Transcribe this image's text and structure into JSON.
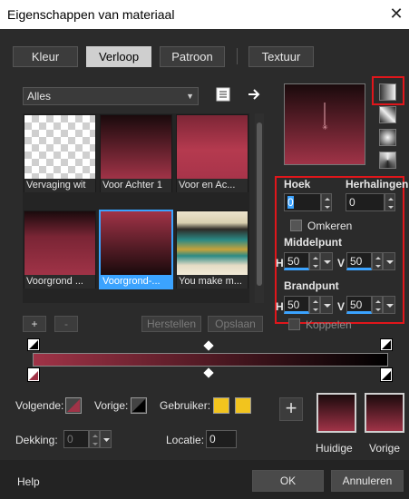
{
  "window": {
    "title": "Eigenschappen van materiaal",
    "close_glyph": "✕"
  },
  "tabs": [
    {
      "label": "Kleur"
    },
    {
      "label": "Verloop"
    },
    {
      "label": "Patroon"
    },
    {
      "label": "Textuur"
    }
  ],
  "filter": {
    "value": "Alles"
  },
  "gradients": [
    {
      "label": "Vervaging wit"
    },
    {
      "label": "Voor Achter 1"
    },
    {
      "label": "Voor en Ac..."
    },
    {
      "label": "Voorgrond ..."
    },
    {
      "label": "Voorgrond-..."
    },
    {
      "label": "You make m..."
    }
  ],
  "library_buttons": {
    "add": "+",
    "remove": "-",
    "restore": "Herstellen",
    "save": "Opslaan"
  },
  "params": {
    "angle_label": "Hoek",
    "angle_value": "0",
    "repeats_label": "Herhalingen",
    "repeats_value": "0",
    "invert_label": "Omkeren",
    "center_label": "Middelpunt",
    "center_h_label": "H",
    "center_h": "50",
    "center_v_label": "V",
    "center_v": "50",
    "focal_label": "Brandpunt",
    "focal_h_label": "H",
    "focal_h": "50",
    "focal_v_label": "V",
    "focal_v": "50",
    "link_label": "Koppelen"
  },
  "stops": {
    "next_label": "Volgende:",
    "prev_label": "Vorige:",
    "user_label": "Gebruiker:",
    "opacity_label": "Dekking:",
    "opacity_value": "0",
    "location_label": "Locatie:",
    "location_value": "0",
    "user_color": "#f2c41e"
  },
  "preview": {
    "current_label": "Huidige",
    "previous_label": "Vorige"
  },
  "footer": {
    "help": "Help",
    "ok": "OK",
    "cancel": "Annuleren"
  },
  "colors": {
    "foreground": "#a03347",
    "background": "#000000",
    "accent": "#3ba3ff",
    "highlight": "#e0161b"
  }
}
